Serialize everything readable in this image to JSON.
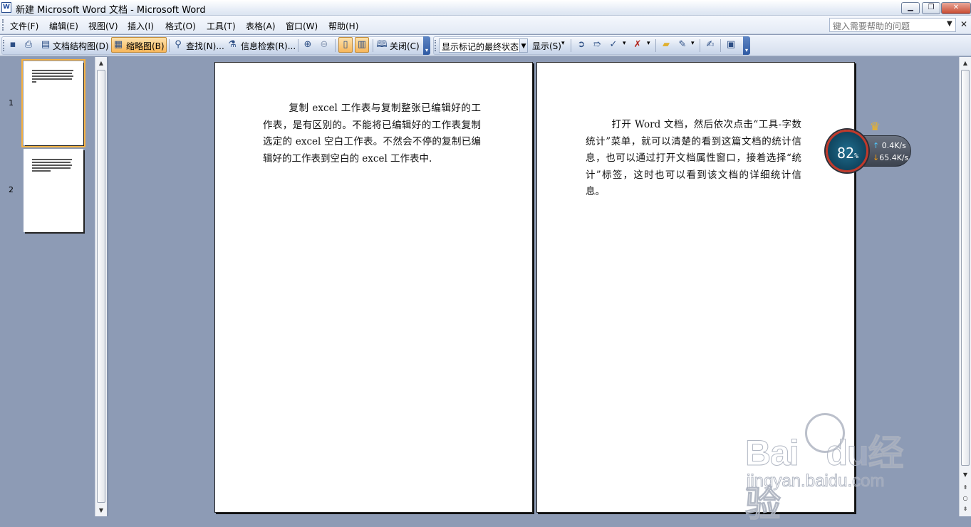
{
  "window": {
    "app_icon": "W",
    "title": "新建 Microsoft Word 文档 - Microsoft Word",
    "minimize_icon": "minimize-icon",
    "restore_icon": "restore-icon",
    "close_icon": "close-icon"
  },
  "menubar": {
    "items": [
      "文件(F)",
      "编辑(E)",
      "视图(V)",
      "插入(I)",
      "格式(O)",
      "工具(T)",
      "表格(A)",
      "窗口(W)",
      "帮助(H)"
    ],
    "help_placeholder": "键入需要帮助的问题"
  },
  "toolbar": {
    "doc_map": "文档结构图(D)",
    "thumbnails": "缩略图(B)",
    "find": "查找(N)...",
    "research": "信息检索(R)...",
    "close": "关闭(C)",
    "markup_combo": "显示标记的最终状态",
    "show": "显示(S)"
  },
  "thumbnails": {
    "pages": [
      "1",
      "2"
    ]
  },
  "pages": {
    "page1_text": "复制 excel 工作表与复制整张已编辑好的工作表，是有区别的。不能将已编辑好的工作表复制选定的 excel 空白工作表。不然会不停的复制已编辑好的工作表到空白的 excel 工作表中.",
    "page2_text": "打开 Word 文档，然后依次点击“工具-字数统计”菜单，就可以清楚的看到这篇文档的统计信息，也可以通过打开文档属性窗口，接着选择“统计”标签，这时也可以看到该文档的详细统计信息。"
  },
  "speed_widget": {
    "percent": "82",
    "percent_unit": "%",
    "upload": "0.4K/s",
    "download": "65.4K/s",
    "badge": "VIP"
  },
  "watermark": {
    "main": "Bai",
    "main2": "du",
    "cn": "经验",
    "sub": "jingyan.baidu.com"
  },
  "colors": {
    "accent_orange": "#f5b041",
    "app_background": "#8d9bb5",
    "widget_ring": "#c0392b"
  }
}
